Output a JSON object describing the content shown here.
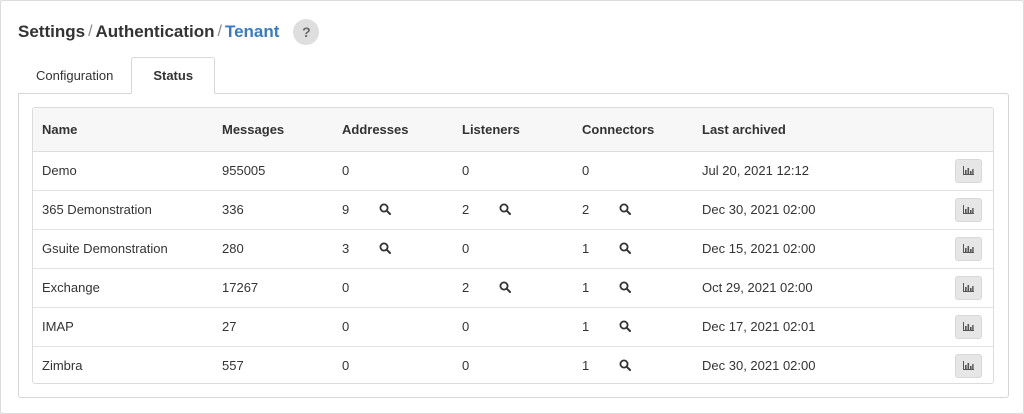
{
  "breadcrumb": {
    "items": [
      "Settings",
      "Authentication",
      "Tenant"
    ],
    "separator": "/"
  },
  "help": {
    "label": "?"
  },
  "tabs": [
    {
      "label": "Configuration",
      "active": false
    },
    {
      "label": "Status",
      "active": true
    }
  ],
  "table": {
    "headers": {
      "name": "Name",
      "messages": "Messages",
      "addresses": "Addresses",
      "listeners": "Listeners",
      "connectors": "Connectors",
      "last_archived": "Last archived"
    },
    "rows": [
      {
        "name": "Demo",
        "messages": "955005",
        "addresses": "0",
        "listeners": "0",
        "connectors": "0",
        "last_archived": "Jul 20, 2021 12:12"
      },
      {
        "name": "365 Demonstration",
        "messages": "336",
        "addresses": "9",
        "listeners": "2",
        "connectors": "2",
        "last_archived": "Dec 30, 2021 02:00"
      },
      {
        "name": "Gsuite Demonstration",
        "messages": "280",
        "addresses": "3",
        "listeners": "0",
        "connectors": "1",
        "last_archived": "Dec 15, 2021 02:00"
      },
      {
        "name": "Exchange",
        "messages": "17267",
        "addresses": "0",
        "listeners": "2",
        "connectors": "1",
        "last_archived": "Oct 29, 2021 02:00"
      },
      {
        "name": "IMAP",
        "messages": "27",
        "addresses": "0",
        "listeners": "0",
        "connectors": "1",
        "last_archived": "Dec 17, 2021 02:01"
      },
      {
        "name": "Zimbra",
        "messages": "557",
        "addresses": "0",
        "listeners": "0",
        "connectors": "1",
        "last_archived": "Dec 30, 2021 02:00"
      }
    ]
  },
  "icons": {
    "search": "search-icon",
    "chart": "bar-chart-icon",
    "help": "question-icon"
  },
  "colors": {
    "accent": "#3a7bbf",
    "button_bg": "#e6e6e6",
    "header_bg": "#f7f7f7"
  }
}
